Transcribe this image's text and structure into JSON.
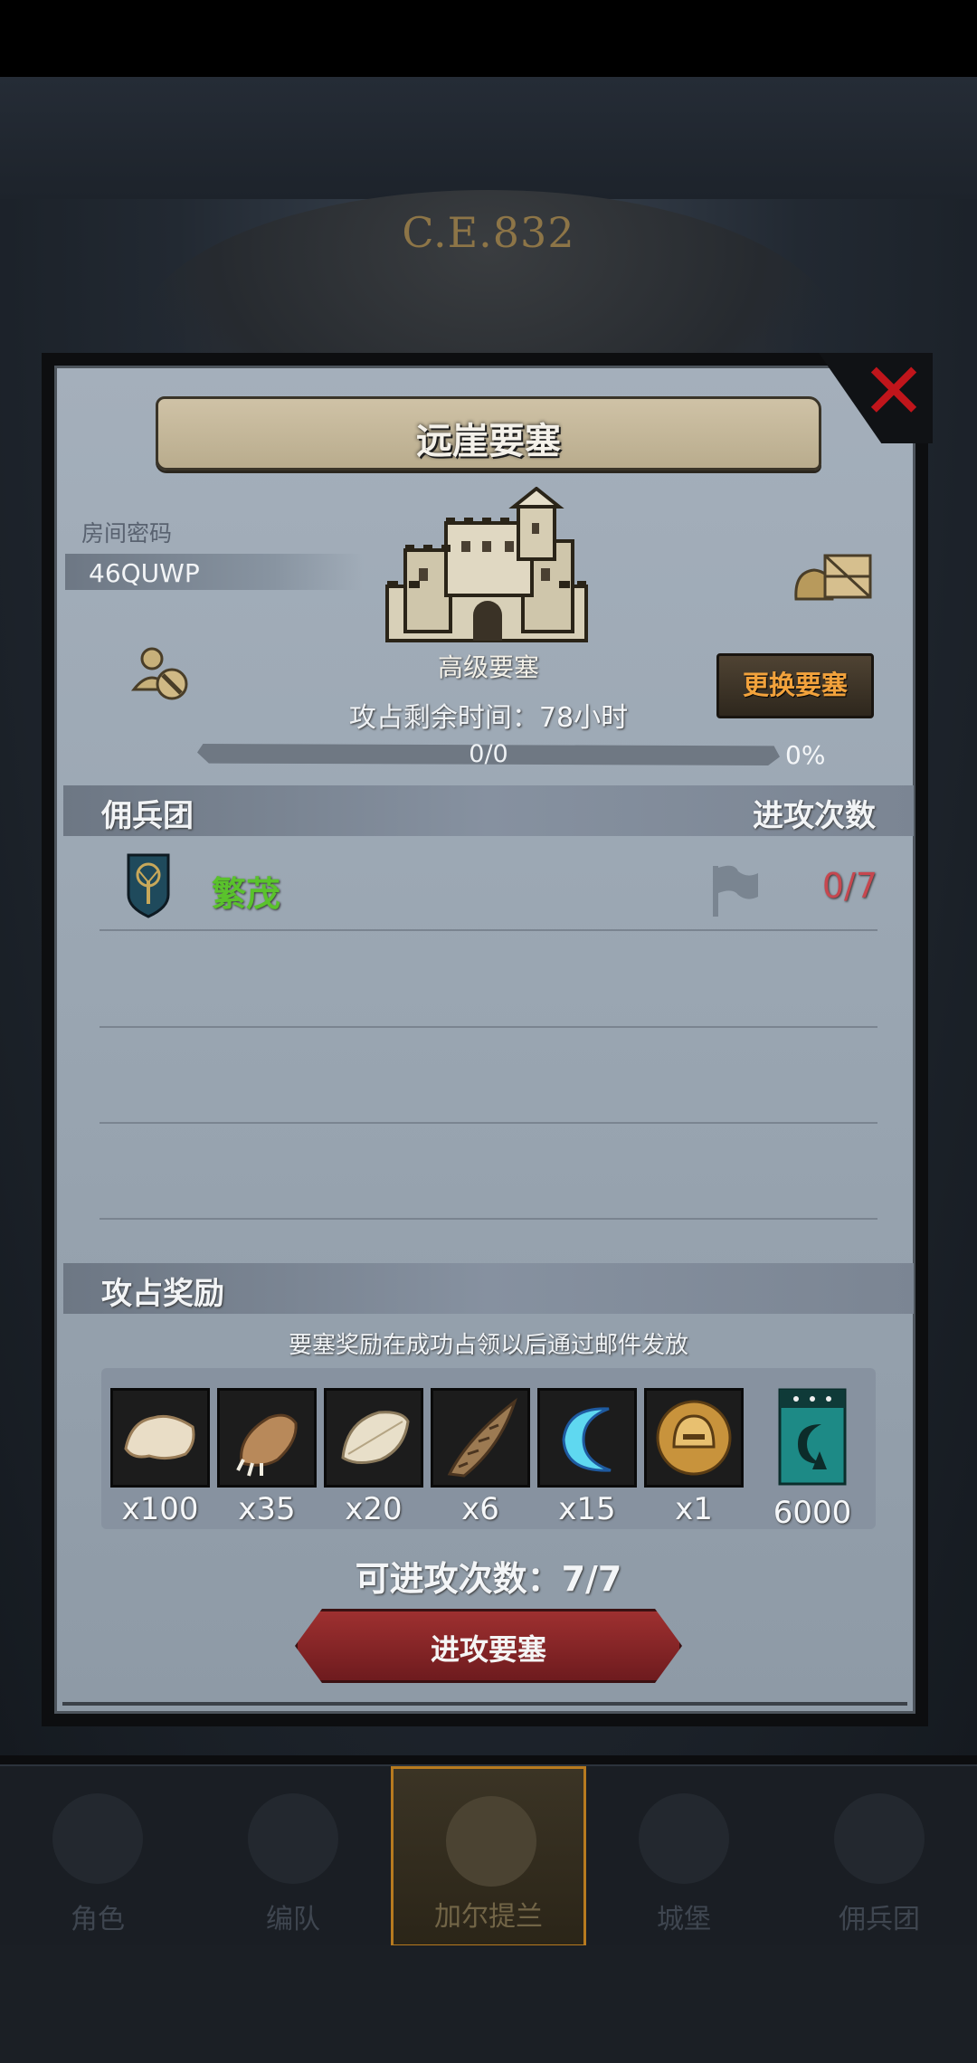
{
  "header": {
    "era": "C.E.832"
  },
  "dialog": {
    "title": "远崖要塞",
    "room": {
      "label": "房间密码",
      "code": "46QUWP"
    },
    "fortress": {
      "grade": "高级要塞",
      "remain_label": "攻占剩余时间：",
      "remain_value": "78小时",
      "progress_text": "0/0",
      "progress_pct": "0%",
      "progress_fraction": 0
    },
    "change_button": "更换要塞",
    "mercenary": {
      "header_left": "佣兵团",
      "header_right": "进攻次数",
      "rows": [
        {
          "name": "繁茂",
          "count": "0/7"
        }
      ]
    },
    "rewards": {
      "title": "攻占奖励",
      "note": "要塞奖励在成功占领以后通过邮件发放",
      "items": [
        {
          "icon": "white-fur-icon",
          "qty": "x100"
        },
        {
          "icon": "claw-paw-icon",
          "qty": "x35"
        },
        {
          "icon": "feather-fur-icon",
          "qty": "x20"
        },
        {
          "icon": "horn-icon",
          "qty": "x6"
        },
        {
          "icon": "blue-crescent-icon",
          "qty": "x15"
        },
        {
          "icon": "gold-helmet-icon",
          "qty": "x1"
        }
      ],
      "ticket": {
        "icon": "guild-banner-icon",
        "qty": "6000"
      }
    },
    "attack_count": "可进攻次数：7/7",
    "attack_button": "进攻要塞"
  },
  "bottom_nav": [
    {
      "label": "角色"
    },
    {
      "label": "编队"
    },
    {
      "label": "加尔提兰",
      "active": true
    },
    {
      "label": "城堡"
    },
    {
      "label": "佣兵团"
    }
  ],
  "colors": {
    "accent": "#f2a23c",
    "merc_name": "#5ac22c",
    "count_red": "#c6474f",
    "attack_btn": "#9e3030"
  }
}
